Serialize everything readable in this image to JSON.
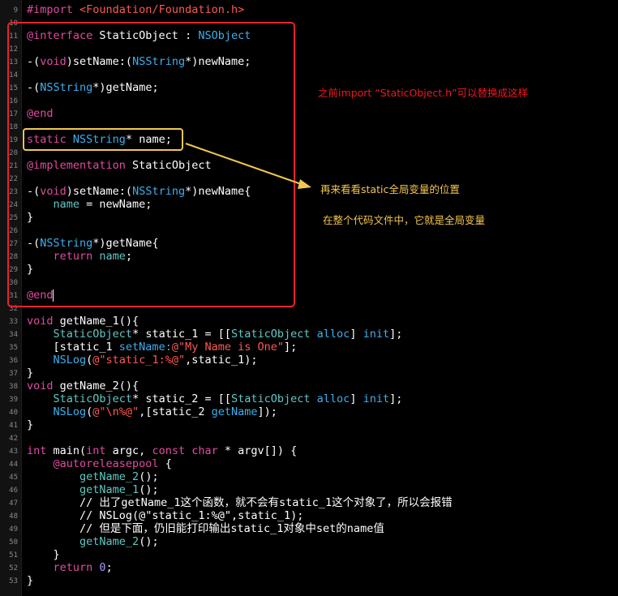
{
  "editor": {
    "colors": {
      "background": "#000000",
      "keyword": "#e24ba0",
      "string": "#fc5a55",
      "type": "#3db0ee",
      "number": "#a99cf6",
      "call": "#5fc9c4",
      "highlight_box": "#e8232d",
      "static_box": "#f3c74f"
    },
    "lines": [
      {
        "num": "9",
        "tokens": [
          {
            "t": "#import ",
            "c": "dir"
          },
          {
            "t": "<Foundation/Foundation.h>",
            "c": "str"
          }
        ]
      },
      {
        "num": "10",
        "tokens": []
      },
      {
        "num": "11",
        "tokens": [
          {
            "t": "@interface ",
            "c": "kw"
          },
          {
            "t": "StaticObject : ",
            "c": "plain"
          },
          {
            "t": "NSObject",
            "c": "type"
          }
        ]
      },
      {
        "num": "12",
        "tokens": []
      },
      {
        "num": "13",
        "tokens": [
          {
            "t": "-(",
            "c": "plain"
          },
          {
            "t": "void",
            "c": "kw"
          },
          {
            "t": ")setName:(",
            "c": "plain"
          },
          {
            "t": "NSString",
            "c": "type"
          },
          {
            "t": "*)newName;",
            "c": "plain"
          }
        ]
      },
      {
        "num": "14",
        "tokens": []
      },
      {
        "num": "15",
        "tokens": [
          {
            "t": "-(",
            "c": "plain"
          },
          {
            "t": "NSString",
            "c": "type"
          },
          {
            "t": "*)getName;",
            "c": "plain"
          }
        ]
      },
      {
        "num": "16",
        "tokens": []
      },
      {
        "num": "17",
        "tokens": [
          {
            "t": "@end",
            "c": "kw"
          }
        ]
      },
      {
        "num": "18",
        "tokens": []
      },
      {
        "num": "19",
        "tokens": [
          {
            "t": "static ",
            "c": "kw"
          },
          {
            "t": "NSString",
            "c": "type"
          },
          {
            "t": "* name;",
            "c": "plain"
          }
        ]
      },
      {
        "num": "20",
        "tokens": []
      },
      {
        "num": "21",
        "tokens": [
          {
            "t": "@implementation ",
            "c": "kw"
          },
          {
            "t": "StaticObject",
            "c": "plain"
          }
        ]
      },
      {
        "num": "22",
        "tokens": []
      },
      {
        "num": "23",
        "tokens": [
          {
            "t": "-(",
            "c": "plain"
          },
          {
            "t": "void",
            "c": "kw"
          },
          {
            "t": ")setName:(",
            "c": "plain"
          },
          {
            "t": "NSString",
            "c": "type"
          },
          {
            "t": "*)newName{",
            "c": "plain"
          }
        ]
      },
      {
        "num": "24",
        "tokens": [
          {
            "t": "    ",
            "c": "plain"
          },
          {
            "t": "name",
            "c": "call"
          },
          {
            "t": " = newName;",
            "c": "plain"
          }
        ]
      },
      {
        "num": "25",
        "tokens": [
          {
            "t": "}",
            "c": "plain"
          }
        ]
      },
      {
        "num": "26",
        "tokens": []
      },
      {
        "num": "27",
        "tokens": [
          {
            "t": "-(",
            "c": "plain"
          },
          {
            "t": "NSString",
            "c": "type"
          },
          {
            "t": "*)getName{",
            "c": "plain"
          }
        ]
      },
      {
        "num": "28",
        "tokens": [
          {
            "t": "    ",
            "c": "plain"
          },
          {
            "t": "return ",
            "c": "kw"
          },
          {
            "t": "name",
            "c": "call"
          },
          {
            "t": ";",
            "c": "plain"
          }
        ]
      },
      {
        "num": "29",
        "tokens": [
          {
            "t": "}",
            "c": "plain"
          }
        ]
      },
      {
        "num": "30",
        "tokens": []
      },
      {
        "num": "31",
        "tokens": [
          {
            "t": "@end",
            "c": "kw"
          }
        ]
      },
      {
        "num": "32",
        "tokens": []
      },
      {
        "num": "33",
        "tokens": [
          {
            "t": "void ",
            "c": "kw"
          },
          {
            "t": "getName_1(){",
            "c": "plain"
          }
        ]
      },
      {
        "num": "34",
        "tokens": [
          {
            "t": "    ",
            "c": "plain"
          },
          {
            "t": "StaticObject",
            "c": "call"
          },
          {
            "t": "* static_1 = [[",
            "c": "plain"
          },
          {
            "t": "StaticObject",
            "c": "call"
          },
          {
            "t": " ",
            "c": "plain"
          },
          {
            "t": "alloc",
            "c": "type"
          },
          {
            "t": "] ",
            "c": "plain"
          },
          {
            "t": "init",
            "c": "type"
          },
          {
            "t": "];",
            "c": "plain"
          }
        ]
      },
      {
        "num": "35",
        "tokens": [
          {
            "t": "    [static_1 ",
            "c": "plain"
          },
          {
            "t": "setName:",
            "c": "type"
          },
          {
            "t": "@\"My Name is One\"",
            "c": "str"
          },
          {
            "t": "];",
            "c": "plain"
          }
        ]
      },
      {
        "num": "36",
        "tokens": [
          {
            "t": "    ",
            "c": "plain"
          },
          {
            "t": "NSLog",
            "c": "type"
          },
          {
            "t": "(",
            "c": "plain"
          },
          {
            "t": "@\"static_1:%@\"",
            "c": "str"
          },
          {
            "t": ",static_1);",
            "c": "plain"
          }
        ]
      },
      {
        "num": "37",
        "tokens": [
          {
            "t": "}",
            "c": "plain"
          }
        ]
      },
      {
        "num": "38",
        "tokens": [
          {
            "t": "void ",
            "c": "kw"
          },
          {
            "t": "getName_2(){",
            "c": "plain"
          }
        ]
      },
      {
        "num": "39",
        "tokens": [
          {
            "t": "    ",
            "c": "plain"
          },
          {
            "t": "StaticObject",
            "c": "call"
          },
          {
            "t": "* static_2 = [[",
            "c": "plain"
          },
          {
            "t": "StaticObject",
            "c": "call"
          },
          {
            "t": " ",
            "c": "plain"
          },
          {
            "t": "alloc",
            "c": "type"
          },
          {
            "t": "] ",
            "c": "plain"
          },
          {
            "t": "init",
            "c": "type"
          },
          {
            "t": "];",
            "c": "plain"
          }
        ]
      },
      {
        "num": "40",
        "tokens": [
          {
            "t": "    ",
            "c": "plain"
          },
          {
            "t": "NSLog",
            "c": "type"
          },
          {
            "t": "(",
            "c": "plain"
          },
          {
            "t": "@\"\\n%@\"",
            "c": "str"
          },
          {
            "t": ",[static_2 ",
            "c": "plain"
          },
          {
            "t": "getName",
            "c": "type"
          },
          {
            "t": "]);",
            "c": "plain"
          }
        ]
      },
      {
        "num": "41",
        "tokens": [
          {
            "t": "}",
            "c": "plain"
          }
        ]
      },
      {
        "num": "42",
        "tokens": []
      },
      {
        "num": "43",
        "tokens": [
          {
            "t": "int ",
            "c": "kw"
          },
          {
            "t": "main(",
            "c": "plain"
          },
          {
            "t": "int ",
            "c": "kw"
          },
          {
            "t": "argc, ",
            "c": "plain"
          },
          {
            "t": "const char ",
            "c": "kw"
          },
          {
            "t": "* argv[]) {",
            "c": "plain"
          }
        ]
      },
      {
        "num": "44",
        "tokens": [
          {
            "t": "    ",
            "c": "plain"
          },
          {
            "t": "@autoreleasepool",
            "c": "kw"
          },
          {
            "t": " {",
            "c": "plain"
          }
        ]
      },
      {
        "num": "45",
        "tokens": [
          {
            "t": "        ",
            "c": "plain"
          },
          {
            "t": "getName_2",
            "c": "call"
          },
          {
            "t": "();",
            "c": "plain"
          }
        ]
      },
      {
        "num": "46",
        "tokens": [
          {
            "t": "        ",
            "c": "plain"
          },
          {
            "t": "getName_1",
            "c": "call"
          },
          {
            "t": "();",
            "c": "plain"
          }
        ]
      },
      {
        "num": "47",
        "tokens": [
          {
            "t": "        // 出了getName_1这个函数，就不会有static_1这个对象了，所以会报错",
            "c": "cm"
          }
        ]
      },
      {
        "num": "48",
        "tokens": [
          {
            "t": "        // NSLog(@\"static_1:%@\",static_1);",
            "c": "cm"
          }
        ]
      },
      {
        "num": "49",
        "tokens": [
          {
            "t": "        // 但是下面，仍旧能打印输出static_1对象中set的name值",
            "c": "cm"
          }
        ]
      },
      {
        "num": "50",
        "tokens": [
          {
            "t": "        ",
            "c": "plain"
          },
          {
            "t": "getName_2",
            "c": "call"
          },
          {
            "t": "();",
            "c": "plain"
          }
        ]
      },
      {
        "num": "51",
        "tokens": [
          {
            "t": "    }",
            "c": "plain"
          }
        ]
      },
      {
        "num": "52",
        "tokens": [
          {
            "t": "    ",
            "c": "plain"
          },
          {
            "t": "return ",
            "c": "kw"
          },
          {
            "t": "0",
            "c": "num"
          },
          {
            "t": ";",
            "c": "plain"
          }
        ]
      },
      {
        "num": "53",
        "tokens": [
          {
            "t": "}",
            "c": "plain"
          }
        ]
      }
    ]
  },
  "annotations": {
    "note_replace": "之前import “StaticObject.h”可以替换成这样",
    "note_look": "再来看看static全局变量的位置",
    "note_global": "在整个代码文件中，它就是全局变量"
  }
}
